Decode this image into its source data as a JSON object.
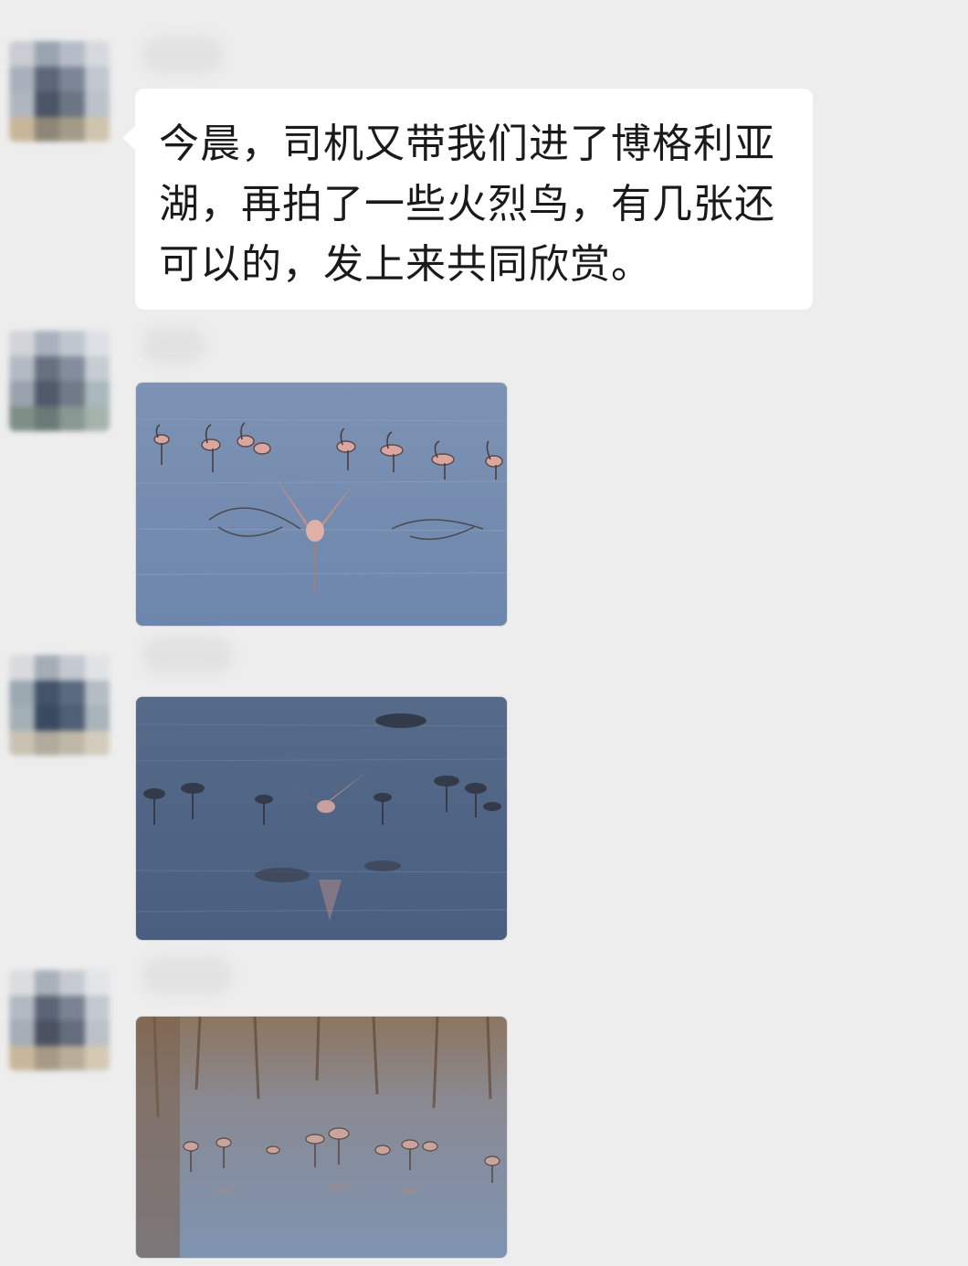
{
  "chat": {
    "messages": [
      {
        "type": "text",
        "sender_name": "",
        "text": "今晨，司机又带我们进了博格利亚湖，再拍了一些火烈鸟，有几张还可以的，发上来共同欣赏。"
      },
      {
        "type": "image",
        "sender_name": "",
        "image": "flamingo-photo"
      },
      {
        "type": "image",
        "sender_name": "",
        "image": "flamingo-photo"
      },
      {
        "type": "image",
        "sender_name": "",
        "image": "flamingo-photo"
      }
    ]
  },
  "colors": {
    "chat_background": "#ededed",
    "bubble_background": "#ffffff",
    "text": "#1a1a1a"
  }
}
